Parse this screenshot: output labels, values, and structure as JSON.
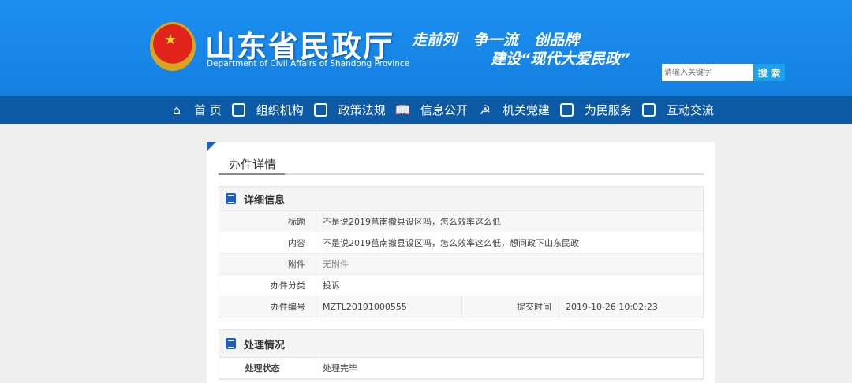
{
  "header": {
    "title": "山东省民政厅",
    "title_en": "Department of Civil Affairs of Shandong Province",
    "slogan_line1": "走前列 争一流 创品牌",
    "slogan_line2": "建设“现代大爱民政”",
    "search_placeholder": "请输入关键字",
    "search_button": "搜 索"
  },
  "nav": [
    {
      "label": "首 页",
      "icon": "home-icon"
    },
    {
      "label": "组织机构",
      "icon": "org-icon"
    },
    {
      "label": "政策法规",
      "icon": "document-icon"
    },
    {
      "label": "信息公开",
      "icon": "book-icon"
    },
    {
      "label": "机关党建",
      "icon": "party-icon"
    },
    {
      "label": "为民服务",
      "icon": "service-icon"
    },
    {
      "label": "互动交流",
      "icon": "chat-icon"
    }
  ],
  "page": {
    "title": "办件详情",
    "detail": {
      "heading": "详细信息",
      "rows": [
        {
          "label": "标题",
          "value": "不是说2019莒南撤县设区吗，怎么效率这么低"
        },
        {
          "label": "内容",
          "value": "不是说2019莒南撤县设区吗，怎么效率这么低，想问政下山东民政"
        },
        {
          "label": "附件",
          "value": "无附件"
        },
        {
          "label": "办件分类",
          "value": "投诉"
        }
      ],
      "number_label": "办件编号",
      "number_value": "MZTL20191000555",
      "time_label": "提交时间",
      "time_value": "2019-10-26 10:02:23"
    },
    "process": {
      "heading": "处理情况",
      "status_label": "处理状态",
      "status_value": "处理完毕"
    }
  }
}
